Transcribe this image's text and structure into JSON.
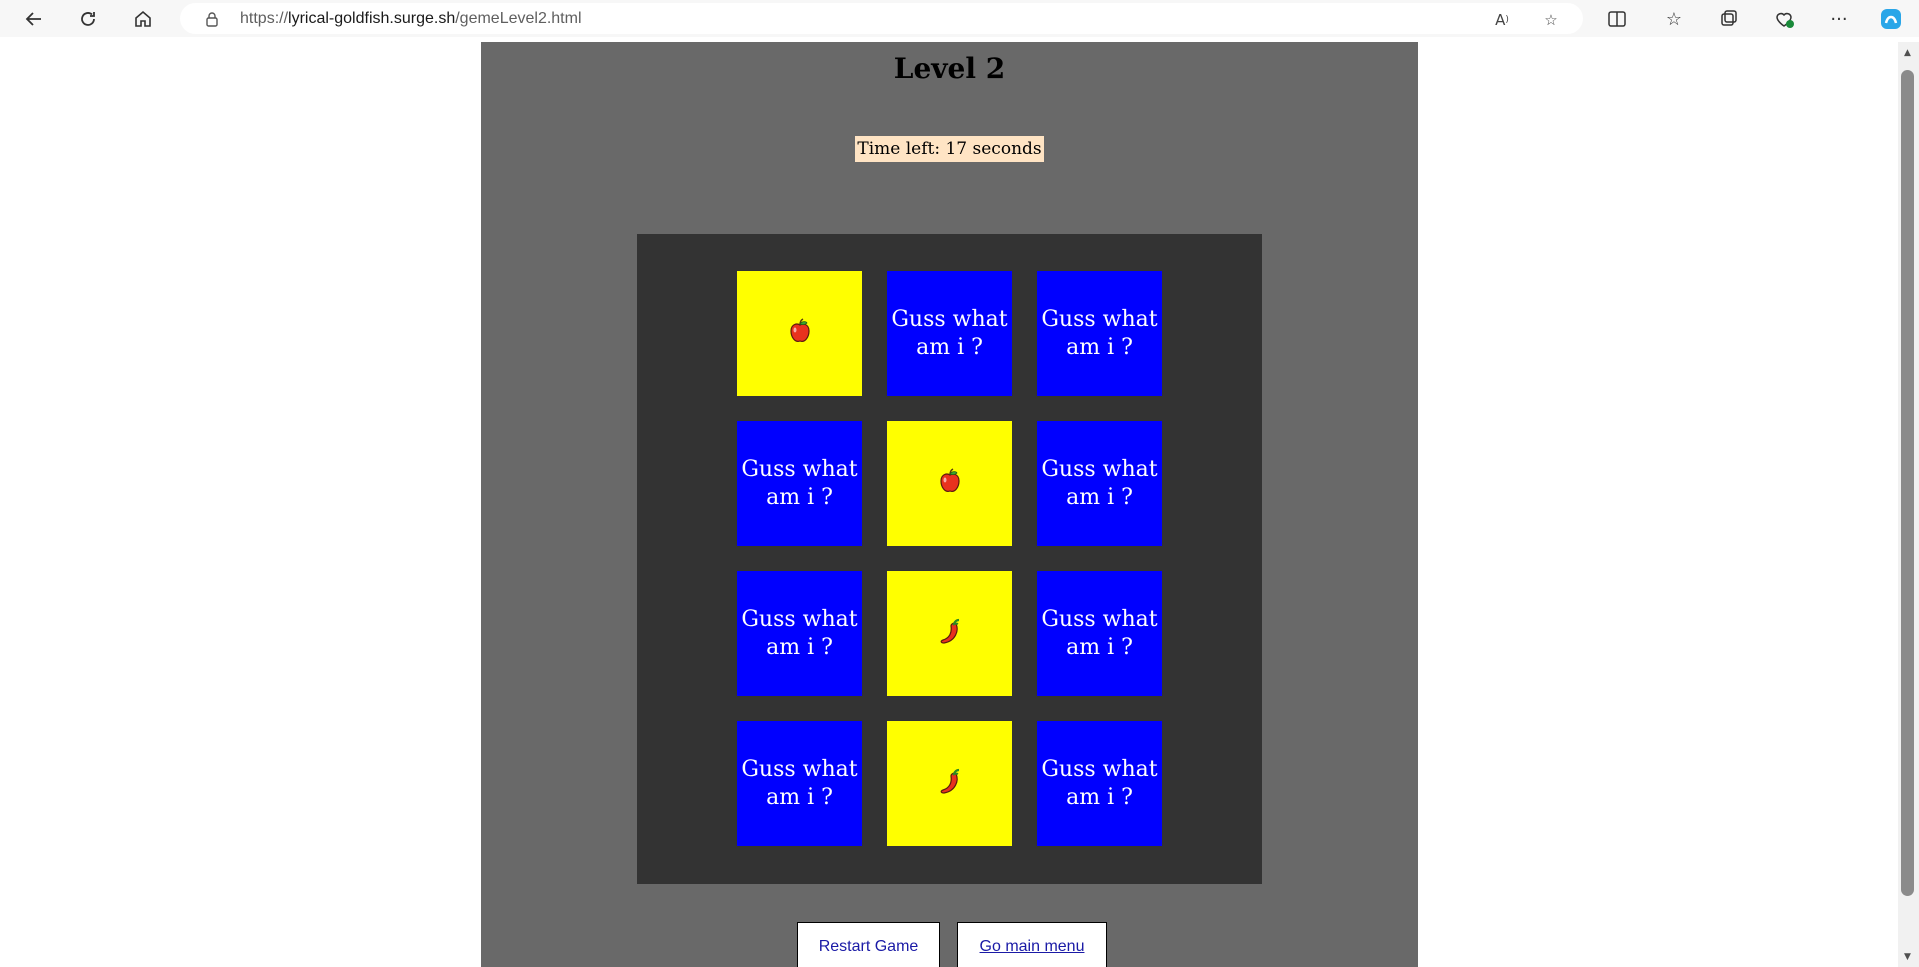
{
  "browser": {
    "url_prefix": "https://",
    "url_host": "lyrical-goldfish.surge.sh",
    "url_path": "/gemeLevel2.html"
  },
  "game": {
    "level_title": "Level 2",
    "timer_text": "Time left: 17 seconds",
    "hidden_label": "Guss what am i ?",
    "cards": [
      {
        "state": "revealed",
        "fruit": "apple-icon"
      },
      {
        "state": "hidden",
        "label": "Guss what am i ?"
      },
      {
        "state": "hidden",
        "label": "Guss what am i ?"
      },
      {
        "state": "hidden",
        "label": "Guss what am i ?"
      },
      {
        "state": "revealed",
        "fruit": "apple-icon"
      },
      {
        "state": "hidden",
        "label": "Guss what am i ?"
      },
      {
        "state": "hidden",
        "label": "Guss what am i ?"
      },
      {
        "state": "revealed",
        "fruit": "chili-pepper-icon"
      },
      {
        "state": "hidden",
        "label": "Guss what am i ?"
      },
      {
        "state": "hidden",
        "label": "Guss what am i ?"
      },
      {
        "state": "revealed",
        "fruit": "chili-pepper-icon"
      },
      {
        "state": "hidden",
        "label": "Guss what am i ?"
      }
    ],
    "colors": {
      "hidden_card": "#0000ff",
      "revealed_card": "#ffff00",
      "board": "#333333",
      "panel": "#696969",
      "timer_bg": "#ffe4c4"
    }
  },
  "buttons": {
    "restart": "Restart Game",
    "main_menu": "Go main menu"
  }
}
